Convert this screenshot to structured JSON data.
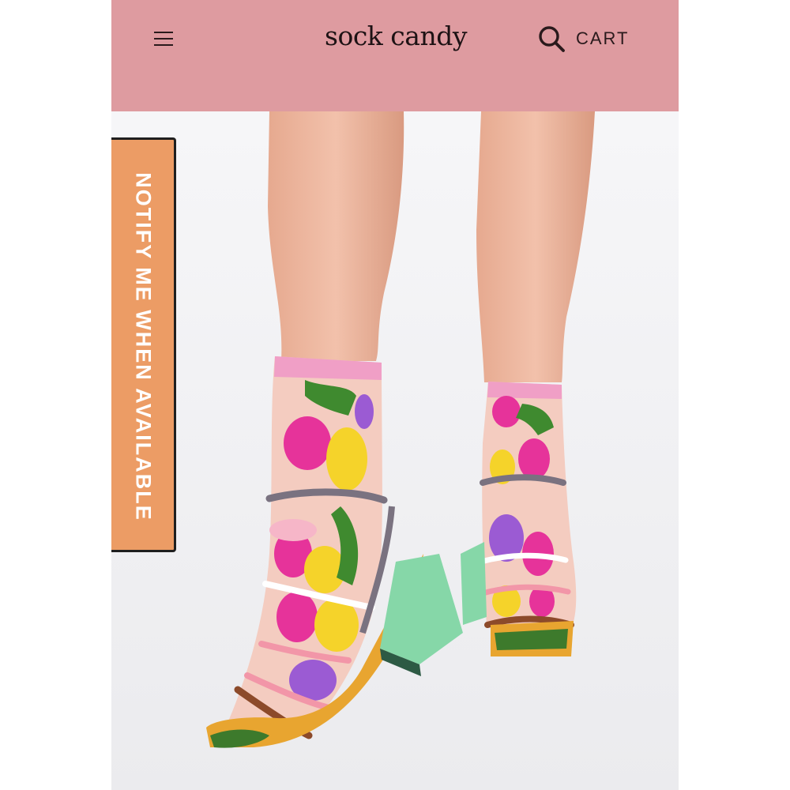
{
  "header": {
    "menu_icon": "hamburger-menu-icon",
    "logo_text": "sock candy",
    "search_icon": "search-icon",
    "cart_label": "CART",
    "background_color": "#de9ba0"
  },
  "notify_tab": {
    "label": "NOTIFY ME WHEN AVAILABLE",
    "background_color": "#ec9c65"
  },
  "hero": {
    "image_description_icon": "product-photo"
  }
}
